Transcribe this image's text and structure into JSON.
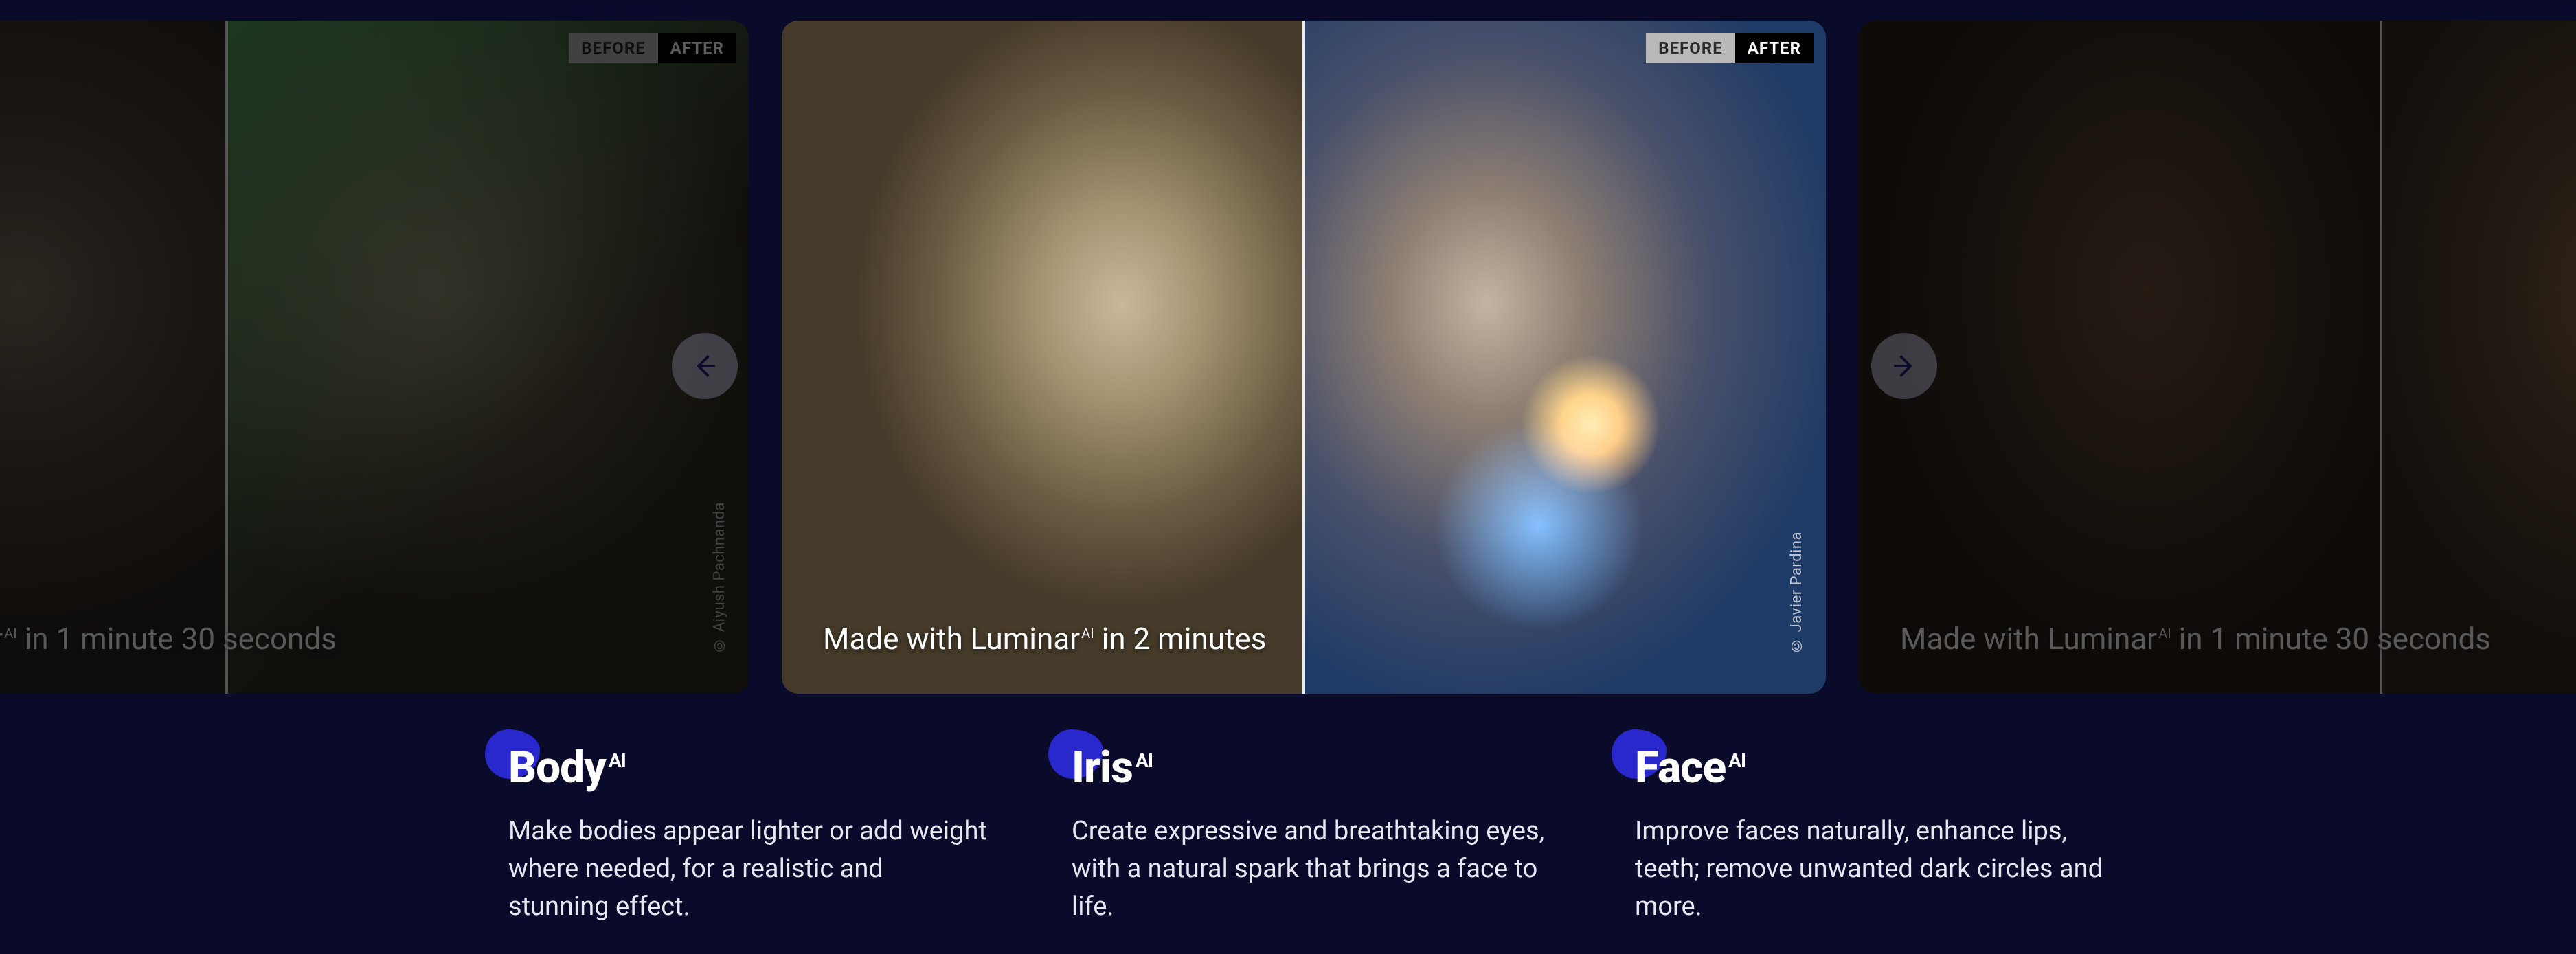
{
  "labels": {
    "before": "BEFORE",
    "after": "AFTER",
    "brand_prefix": "Made with Luminar",
    "brand_sup": "AI"
  },
  "cards": [
    {
      "caption_suffix": " in 1 minute 30 seconds",
      "credit": "© Aiyush Pachnanda"
    },
    {
      "caption_suffix": " in 2 minutes",
      "credit": "© Javier Pardina"
    },
    {
      "caption_suffix": " in 1 minute 30 seconds",
      "credit": ""
    }
  ],
  "features": [
    {
      "title": "Body",
      "sup": "AI",
      "desc": "Make bodies appear lighter or add weight where needed, for a realistic and stunning effect."
    },
    {
      "title": "Iris",
      "sup": "AI",
      "desc": "Create expressive and breathtaking eyes, with a natural spark that brings a face to life."
    },
    {
      "title": "Face",
      "sup": "AI",
      "desc": "Improve faces naturally, enhance lips, teeth; remove unwanted dark circles and more."
    }
  ]
}
